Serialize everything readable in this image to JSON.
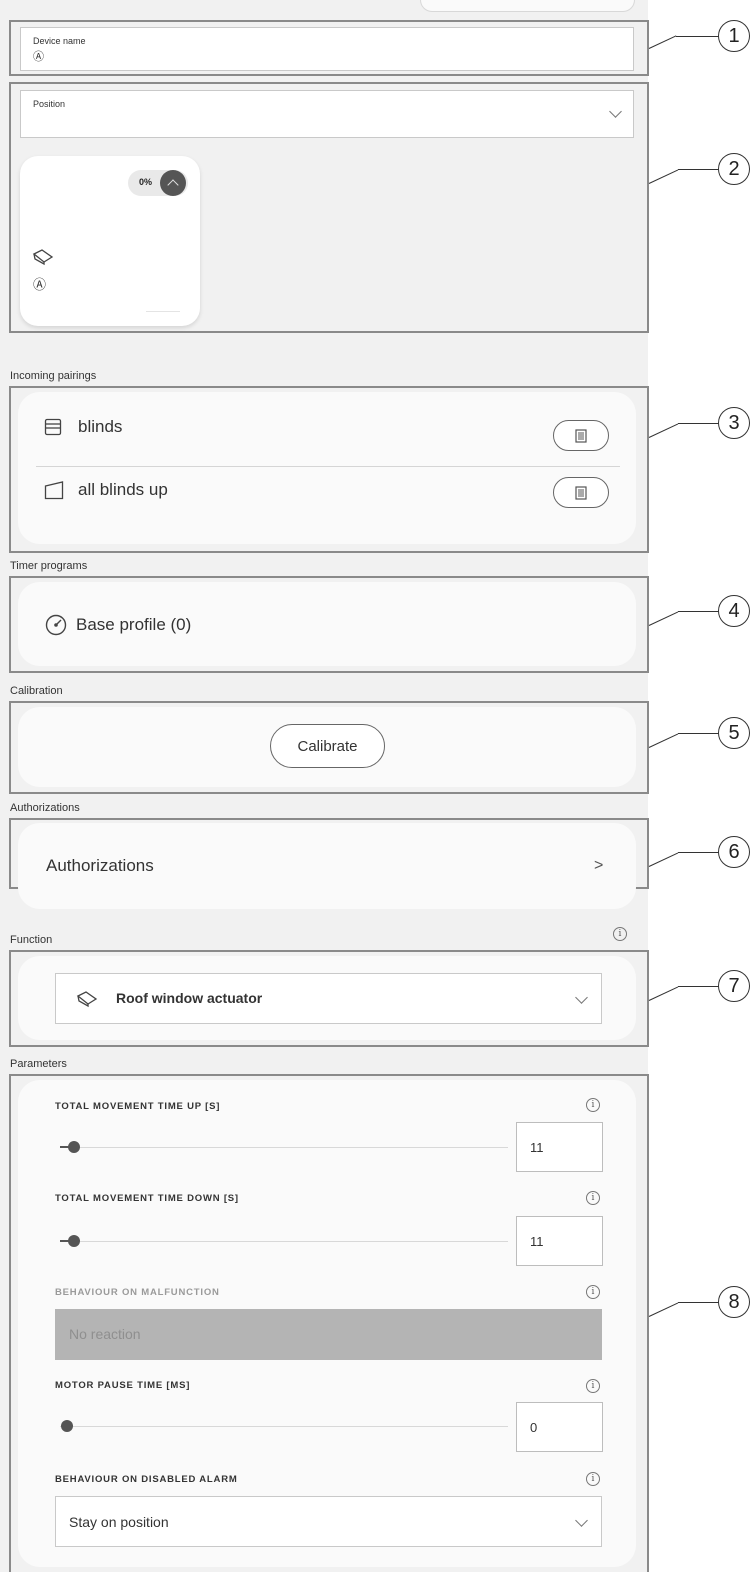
{
  "device_name": {
    "label": "Device name",
    "value": "Ⓐ"
  },
  "position": {
    "label": "Position",
    "tile": {
      "percent": "0%",
      "name": "Ⓐ",
      "icon": "roof-window-icon"
    }
  },
  "incoming_pairings": {
    "label": "Incoming pairings",
    "items": [
      {
        "label": "blinds",
        "icon": "blind-closed-icon"
      },
      {
        "label": "all blinds up",
        "icon": "blind-open-icon"
      }
    ]
  },
  "timer_programs": {
    "label": "Timer programs",
    "items": [
      {
        "label": "Base profile (0)",
        "icon": "clock-check-icon"
      }
    ]
  },
  "calibration": {
    "label": "Calibration",
    "button": "Calibrate"
  },
  "authorizations": {
    "label": "Authorizations",
    "row_label": "Authorizations",
    "chevron": ">"
  },
  "function": {
    "label": "Function",
    "info": "i",
    "value": "Roof window actuator",
    "icon": "roof-window-icon"
  },
  "parameters": {
    "label": "Parameters",
    "info": "i",
    "total_up": {
      "label": "TOTAL MOVEMENT TIME UP [S]",
      "value": "11",
      "slider_fraction": 0.03
    },
    "total_down": {
      "label": "TOTAL MOVEMENT TIME DOWN [S]",
      "value": "11",
      "slider_fraction": 0.03
    },
    "malfunction": {
      "label": "BEHAVIOUR ON MALFUNCTION",
      "value": "No reaction"
    },
    "motor_pause": {
      "label": "MOTOR PAUSE TIME [MS]",
      "value": "0",
      "slider_fraction": 0.0
    },
    "disabled_alarm": {
      "label": "BEHAVIOUR ON DISABLED ALARM",
      "value": "Stay on position"
    }
  },
  "callouts": [
    "1",
    "2",
    "3",
    "4",
    "5",
    "6",
    "7",
    "8"
  ],
  "colors": {
    "page_background": "#f1f1f1",
    "card_background": "#fafafa",
    "frame": "#8a8a8a",
    "disabled_field": "#b4b4b4",
    "position_badge": "#555555"
  }
}
